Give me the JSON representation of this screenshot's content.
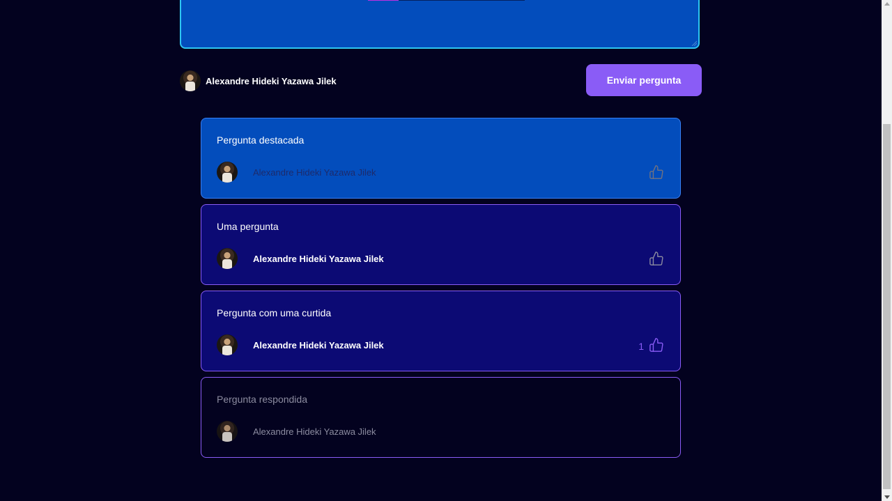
{
  "form": {
    "user_name": "Alexandre Hideki Yazawa Jilek",
    "submit_label": "Enviar pergunta"
  },
  "questions": [
    {
      "content": "Pergunta destacada",
      "author": "Alexandre Hideki Yazawa Jilek",
      "likes": "",
      "state": "highlighted"
    },
    {
      "content": "Uma pergunta",
      "author": "Alexandre Hideki Yazawa Jilek",
      "likes": "",
      "state": "default"
    },
    {
      "content": "Pergunta com uma curtida",
      "author": "Alexandre Hideki Yazawa Jilek",
      "likes": "1",
      "state": "liked"
    },
    {
      "content": "Pergunta respondida",
      "author": "Alexandre Hideki Yazawa Jilek",
      "likes": "",
      "state": "answered"
    }
  ],
  "icons": {
    "avatar": "user-photo",
    "like": "thumbs-up-icon"
  },
  "colors": {
    "background": "#03021f",
    "accent": "#8a5cf6",
    "highlighted_card": "#034dbc",
    "default_card": "#0c0a74",
    "textarea_border": "#2ec6f0"
  }
}
